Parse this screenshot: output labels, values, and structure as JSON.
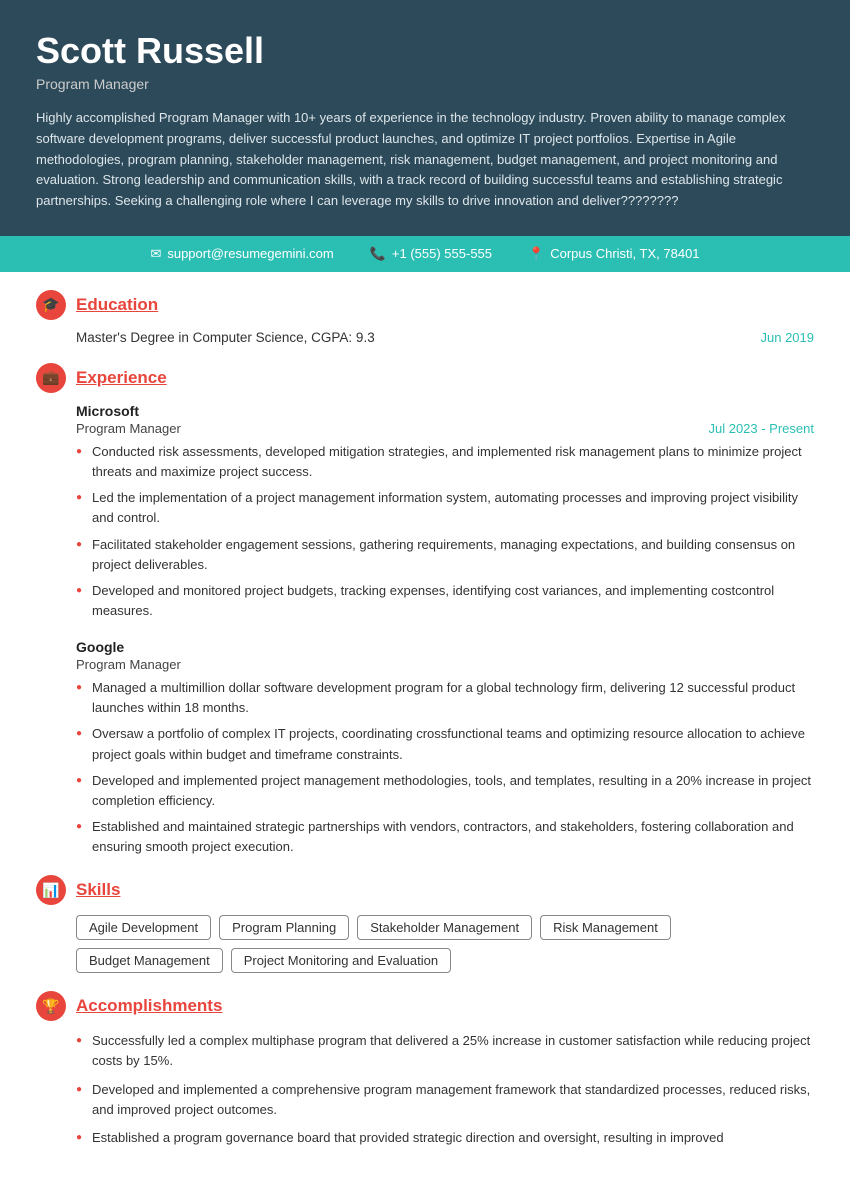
{
  "header": {
    "name": "Scott Russell",
    "title": "Program Manager",
    "summary": "Highly accomplished Program Manager with 10+ years of experience in the technology industry. Proven ability to manage complex software development programs, deliver successful product launches, and optimize IT project portfolios. Expertise in Agile methodologies, program planning, stakeholder management, risk management, budget management, and project monitoring and evaluation. Strong leadership and communication skills, with a track record of building successful teams and establishing strategic partnerships. Seeking a challenging role where I can leverage my skills to drive innovation and deliver????????"
  },
  "contact": {
    "email": "support@resumegemini.com",
    "phone": "+1 (555) 555-555",
    "location": "Corpus Christi, TX, 78401"
  },
  "sections": {
    "education": {
      "title": "Education",
      "icon": "🎓",
      "degree": "Master's Degree in Computer Science, CGPA: 9.3",
      "date": "Jun 2019"
    },
    "experience": {
      "title": "Experience",
      "icon": "💼",
      "entries": [
        {
          "company": "Microsoft",
          "role": "Program Manager",
          "dates": "Jul 2023 - Present",
          "bullets": [
            "Conducted risk assessments, developed mitigation strategies, and implemented risk management plans to minimize project threats and maximize project success.",
            "Led the implementation of a project management information system, automating processes and improving project visibility and control.",
            "Facilitated stakeholder engagement sessions, gathering requirements, managing expectations, and building consensus on project deliverables.",
            "Developed and monitored project budgets, tracking expenses, identifying cost variances, and implementing costcontrol measures."
          ]
        },
        {
          "company": "Google",
          "role": "Program Manager",
          "dates": "",
          "bullets": [
            "Managed a multimillion dollar software development program for a global technology firm, delivering 12 successful product launches within 18 months.",
            "Oversaw a portfolio of complex IT projects, coordinating crossfunctional teams and optimizing resource allocation to achieve project goals within budget and timeframe constraints.",
            "Developed and implemented project management methodologies, tools, and templates, resulting in a 20% increase in project completion efficiency.",
            "Established and maintained strategic partnerships with vendors, contractors, and stakeholders, fostering collaboration and ensuring smooth project execution."
          ]
        }
      ]
    },
    "skills": {
      "title": "Skills",
      "icon": "📊",
      "items": [
        "Agile Development",
        "Program Planning",
        "Stakeholder Management",
        "Risk Management",
        "Budget Management",
        "Project Monitoring and Evaluation"
      ]
    },
    "accomplishments": {
      "title": "Accomplishments",
      "icon": "🏆",
      "items": [
        "Successfully led a complex multiphase program that delivered a 25% increase in customer satisfaction while reducing project costs by 15%.",
        "Developed and implemented a comprehensive program management framework that standardized processes, reduced risks, and improved project outcomes.",
        "Established a program governance board that provided strategic direction and oversight, resulting in improved"
      ]
    }
  }
}
